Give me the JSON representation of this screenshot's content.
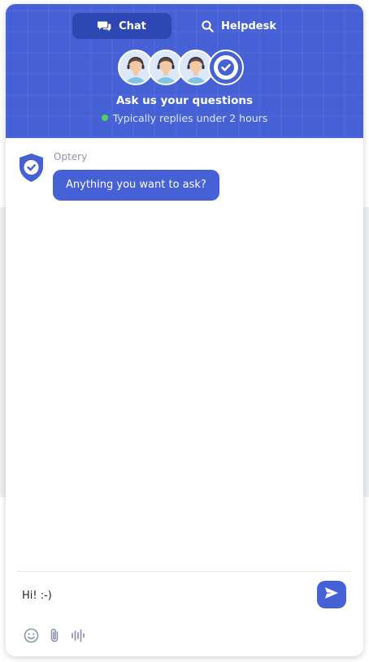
{
  "header": {
    "tabs": [
      {
        "label": "Chat",
        "icon": "chat-icon",
        "active": true
      },
      {
        "label": "Helpdesk",
        "icon": "search-icon",
        "active": false
      }
    ],
    "title": "Ask us your questions",
    "status": "Typically replies under 2 hours",
    "status_color": "#4fd15c"
  },
  "messages": [
    {
      "sender": "Optery",
      "text": "Anything you want to ask?"
    }
  ],
  "composer": {
    "value": "Hi! :-)",
    "tools": [
      "emoji-icon",
      "attachment-icon",
      "voice-icon"
    ]
  },
  "colors": {
    "accent": "#4661d6",
    "accent_dark": "#2e48b3"
  }
}
